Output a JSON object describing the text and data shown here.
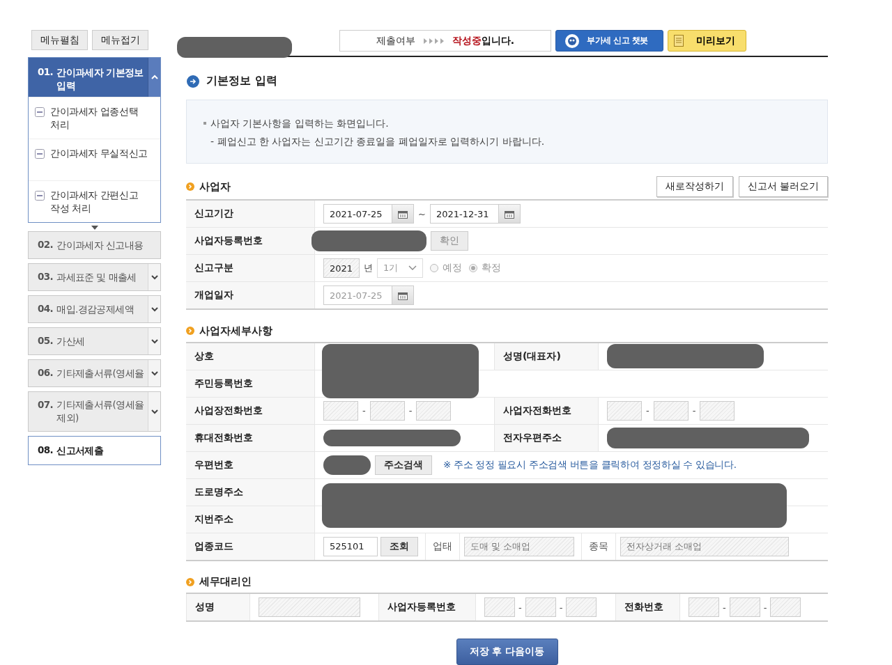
{
  "sidebar": {
    "buttons": [
      "메뉴펼침",
      "메뉴접기"
    ],
    "steps": [
      {
        "number": "01.",
        "label": "간이과세자 기본정보 입력",
        "kind": "section",
        "selected": true,
        "expanded": true,
        "children": [
          {
            "label": "간이과세자 업종선택 처리"
          },
          {
            "label": "간이과세자 무실적신고"
          },
          {
            "label": "간이과세자 간편신고 작성 처리"
          }
        ]
      },
      {
        "number": "02.",
        "label": "간이과세자 신고내용",
        "kind": "section",
        "selected": false
      },
      {
        "number": "03.",
        "label": "과세표준 및 매출세",
        "kind": "section",
        "selected": false,
        "expanded": false
      },
      {
        "number": "04.",
        "label": "매입.경감공제세액",
        "kind": "section",
        "selected": false,
        "expanded": false
      },
      {
        "number": "05.",
        "label": "가산세",
        "kind": "section",
        "selected": false,
        "expanded": false
      },
      {
        "number": "06.",
        "label": "기타제출서류(영세율",
        "kind": "section",
        "selected": false,
        "expanded": false
      },
      {
        "number": "07.",
        "label": "기타제출서류(영세율 제외)",
        "kind": "section",
        "selected": false,
        "expanded": false
      },
      {
        "number": "08.",
        "label": "신고서제출",
        "kind": "submit",
        "selected": false
      }
    ]
  },
  "header": {
    "status_label": "제출여부",
    "status_value": "작성중",
    "status_suffix": "입니다.",
    "chatbot_button": "부가세 신고 챗봇",
    "preview_button": "미리보기"
  },
  "title": "기본정보 입력",
  "notice": [
    "사업자 기본사항을 입력하는 화면입니다.",
    "- 폐업신고 한 사업자는 신고기간 종료일을 폐업일자로 입력하시기 바랍니다."
  ],
  "sections": [
    {
      "title": "사업자",
      "buttons": [
        "새로작성하기",
        "신고서 불러오기"
      ],
      "rows": [
        {
          "cells": [
            {
              "kind": "head",
              "text": "신고기간"
            },
            {
              "kind": "value",
              "controls": [
                {
                  "kind": "date",
                  "value": "2021-07-25",
                  "disabled": false
                },
                {
                  "kind": "sep",
                  "text": "~"
                },
                {
                  "kind": "date",
                  "value": "2021-12-31",
                  "disabled": false
                }
              ]
            }
          ]
        },
        {
          "cells": [
            {
              "kind": "head",
              "text": "사업자등록번호"
            },
            {
              "kind": "value",
              "controls": [
                {
                  "kind": "redacted"
                },
                {
                  "kind": "button",
                  "text": "확인",
                  "disabled": true
                }
              ]
            }
          ]
        },
        {
          "cells": [
            {
              "kind": "head",
              "text": "신고구분"
            },
            {
              "kind": "value",
              "controls": [
                {
                  "kind": "text",
                  "value": "2021",
                  "disabled": true
                },
                {
                  "kind": "sep",
                  "text": "년"
                },
                {
                  "kind": "select",
                  "value": "1기",
                  "disabled": true
                },
                {
                  "kind": "radio",
                  "label": "예정",
                  "selected": false,
                  "disabled": true
                },
                {
                  "kind": "radio",
                  "label": "확정",
                  "selected": true,
                  "disabled": true
                }
              ]
            }
          ]
        },
        {
          "cells": [
            {
              "kind": "head",
              "text": "개업일자"
            },
            {
              "kind": "value",
              "controls": [
                {
                  "kind": "date",
                  "value": "2021-07-25",
                  "disabled": true
                }
              ]
            }
          ]
        }
      ]
    },
    {
      "title": "사업자세부사항",
      "rows": [
        {
          "cells": [
            {
              "kind": "head",
              "text": "상호"
            },
            {
              "kind": "value",
              "controls": [
                {
                  "kind": "redacted",
                  "tall": true
                }
              ]
            },
            {
              "kind": "head",
              "text": "성명(대표자)"
            },
            {
              "kind": "value",
              "controls": [
                {
                  "kind": "redacted"
                }
              ]
            }
          ]
        },
        {
          "cells": [
            {
              "kind": "head",
              "text": "주민등록번호"
            },
            {
              "kind": "value"
            }
          ]
        },
        {
          "cells": [
            {
              "kind": "head",
              "text": "사업장전화번호"
            },
            {
              "kind": "value",
              "controls": [
                {
                  "kind": "blank"
                },
                {
                  "kind": "sep",
                  "text": "-"
                },
                {
                  "kind": "blank"
                },
                {
                  "kind": "sep",
                  "text": "-"
                },
                {
                  "kind": "blank"
                }
              ]
            },
            {
              "kind": "head",
              "text": "사업자전화번호"
            },
            {
              "kind": "value",
              "controls": [
                {
                  "kind": "blank"
                },
                {
                  "kind": "sep",
                  "text": "-"
                },
                {
                  "kind": "blank"
                },
                {
                  "kind": "sep",
                  "text": "-"
                },
                {
                  "kind": "blank"
                }
              ]
            }
          ]
        },
        {
          "cells": [
            {
              "kind": "head",
              "text": "휴대전화번호"
            },
            {
              "kind": "value",
              "controls": [
                {
                  "kind": "redacted"
                }
              ]
            },
            {
              "kind": "head",
              "text": "전자우편주소"
            },
            {
              "kind": "value",
              "controls": [
                {
                  "kind": "redacted"
                }
              ]
            }
          ]
        },
        {
          "cells": [
            {
              "kind": "head",
              "text": "우편번호"
            },
            {
              "kind": "value",
              "controls": [
                {
                  "kind": "redacted"
                },
                {
                  "kind": "button",
                  "text": "주소검색",
                  "disabled": false
                },
                {
                  "kind": "note",
                  "text": "※ 주소 정정 필요시 주소검색 버튼을 클릭하여 정정하실 수 있습니다."
                }
              ]
            }
          ]
        },
        {
          "cells": [
            {
              "kind": "head",
              "text": "도로명주소"
            },
            {
              "kind": "value",
              "controls": [
                {
                  "kind": "redacted",
                  "tall": true
                }
              ]
            }
          ]
        },
        {
          "cells": [
            {
              "kind": "head",
              "text": "지번주소"
            },
            {
              "kind": "value"
            }
          ]
        },
        {
          "cells": [
            {
              "kind": "head",
              "text": "업종코드"
            },
            {
              "kind": "value",
              "controls": [
                {
                  "kind": "text",
                  "value": "525101",
                  "disabled": false
                },
                {
                  "kind": "button",
                  "text": "조회",
                  "disabled": false
                },
                {
                  "kind": "label",
                  "text": "업태"
                },
                {
                  "kind": "text",
                  "value": "도매 및 소매업",
                  "disabled": true
                },
                {
                  "kind": "label",
                  "text": "종목"
                },
                {
                  "kind": "text",
                  "value": "전자상거래 소매업",
                  "disabled": true
                }
              ]
            }
          ]
        }
      ]
    },
    {
      "title": "세무대리인",
      "rows": [
        {
          "cells": [
            {
              "kind": "head",
              "text": "성명"
            },
            {
              "kind": "value",
              "controls": [
                {
                  "kind": "blank"
                }
              ]
            },
            {
              "kind": "head",
              "text": "사업자등록번호"
            },
            {
              "kind": "value",
              "controls": [
                {
                  "kind": "blank"
                },
                {
                  "kind": "sep",
                  "text": "-"
                },
                {
                  "kind": "blank"
                },
                {
                  "kind": "sep",
                  "text": "-"
                },
                {
                  "kind": "blank"
                }
              ]
            },
            {
              "kind": "head",
              "text": "전화번호"
            },
            {
              "kind": "value",
              "controls": [
                {
                  "kind": "blank"
                },
                {
                  "kind": "sep",
                  "text": "-"
                },
                {
                  "kind": "blank"
                },
                {
                  "kind": "sep",
                  "text": "-"
                },
                {
                  "kind": "blank"
                }
              ]
            }
          ]
        }
      ]
    }
  ],
  "save_button": "저장 후 다음이동"
}
